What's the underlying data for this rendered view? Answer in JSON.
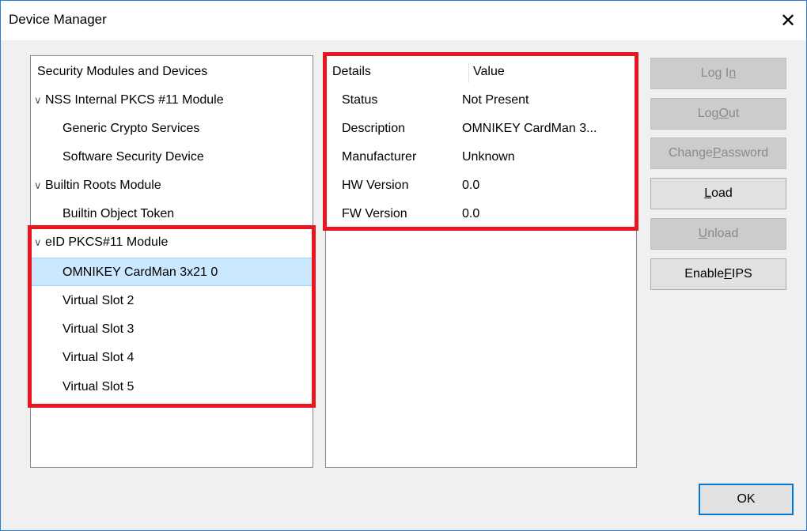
{
  "window": {
    "title": "Device Manager",
    "close_glyph": "✕"
  },
  "tree": {
    "header": "Security Modules and Devices",
    "chevron": "∨",
    "items": [
      {
        "label": "NSS Internal PKCS #11 Module",
        "level": 0,
        "expanded": true
      },
      {
        "label": "Generic Crypto Services",
        "level": 1
      },
      {
        "label": "Software Security Device",
        "level": 1
      },
      {
        "label": "Builtin Roots Module",
        "level": 0,
        "expanded": true
      },
      {
        "label": "Builtin Object Token",
        "level": 1
      },
      {
        "label": "eID PKCS#11 Module",
        "level": 0,
        "expanded": true
      },
      {
        "label": "OMNIKEY CardMan 3x21 0",
        "level": 1,
        "selected": true
      },
      {
        "label": "Virtual Slot 2",
        "level": 1
      },
      {
        "label": "Virtual Slot 3",
        "level": 1
      },
      {
        "label": "Virtual Slot 4",
        "level": 1
      },
      {
        "label": "Virtual Slot 5",
        "level": 1
      }
    ]
  },
  "details": {
    "col_details": "Details",
    "col_value": "Value",
    "rows": [
      {
        "key": "Status",
        "value": "Not Present"
      },
      {
        "key": "Description",
        "value": "OMNIKEY CardMan 3..."
      },
      {
        "key": "Manufacturer",
        "value": "Unknown"
      },
      {
        "key": "HW Version",
        "value": "0.0"
      },
      {
        "key": "FW Version",
        "value": "0.0"
      }
    ]
  },
  "buttons": {
    "login": {
      "pre": "Log I",
      "ul": "n",
      "post": "",
      "enabled": false
    },
    "logout": {
      "pre": "Log ",
      "ul": "O",
      "post": "ut",
      "enabled": false
    },
    "change_password": {
      "pre": "Change ",
      "ul": "P",
      "post": "assword",
      "enabled": false
    },
    "load": {
      "pre": "",
      "ul": "L",
      "post": "oad",
      "enabled": true
    },
    "unload": {
      "pre": "",
      "ul": "U",
      "post": "nload",
      "enabled": false
    },
    "enable_fips": {
      "pre": "Enable ",
      "ul": "F",
      "post": "IPS",
      "enabled": true
    },
    "ok": "OK"
  },
  "colors": {
    "highlight": "#e8161f",
    "selection": "#cce8ff",
    "window_border": "#2b7bd6"
  }
}
